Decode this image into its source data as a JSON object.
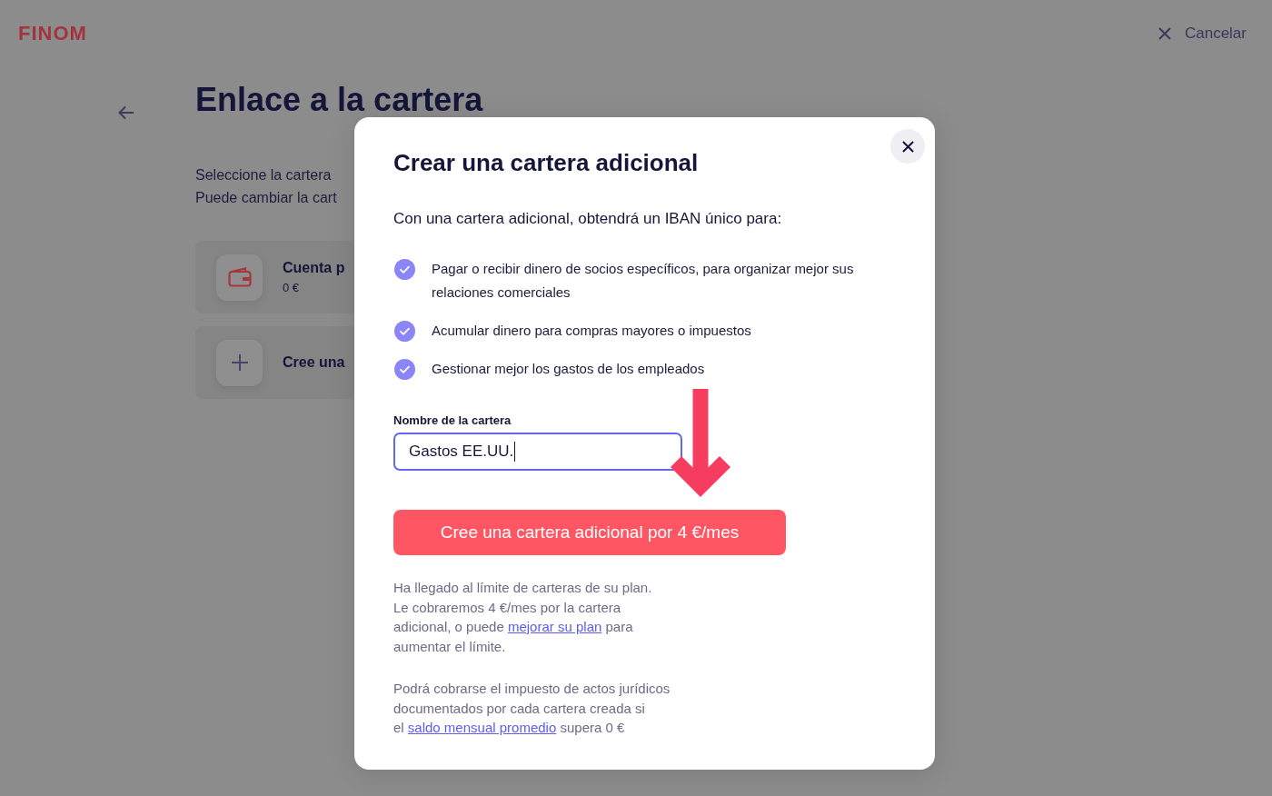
{
  "header": {
    "logo": "FINOM",
    "cancel": "Cancelar"
  },
  "page": {
    "title": "Enlace a la cartera",
    "subtitle": [
      "Seleccione la cartera",
      "Puede cambiar la cart"
    ],
    "wallets": [
      {
        "kind": "account",
        "name": "Cuenta p",
        "balance": "0 €"
      },
      {
        "kind": "create",
        "name": "Cree una"
      }
    ]
  },
  "modal": {
    "title": "Crear una cartera adicional",
    "intro": "Con una cartera adicional, obtendrá un IBAN único para:",
    "benefits": [
      "Pagar o recibir dinero de socios específicos, para organizar mejor sus relaciones comerciales",
      "Acumular dinero para compras mayores o impuestos",
      "Gestionar mejor los gastos de los empleados"
    ],
    "field": {
      "label": "Nombre de la cartera",
      "value": "Gastos EE.UU.",
      "focused": true
    },
    "button": "Cree una cartera adicional por 4 €/mes",
    "notes": [
      {
        "parts": [
          {
            "kind": "text",
            "text": "Ha llegado al límite de carteras de su plan.\nLe cobraremos 4 €/mes por la cartera\nadicional, o puede "
          },
          {
            "kind": "link",
            "text": "mejorar su plan"
          },
          {
            "kind": "text",
            "text": " para\naumentar el límite."
          }
        ]
      },
      {
        "parts": [
          {
            "kind": "text",
            "text": "Podrá cobrarse el impuesto de actos jurídicos\ndocumentados por cada cartera creada si\nel "
          },
          {
            "kind": "link",
            "text": "saldo mensual promedio"
          },
          {
            "kind": "text",
            "text": " supera 0 €"
          }
        ]
      }
    ]
  }
}
